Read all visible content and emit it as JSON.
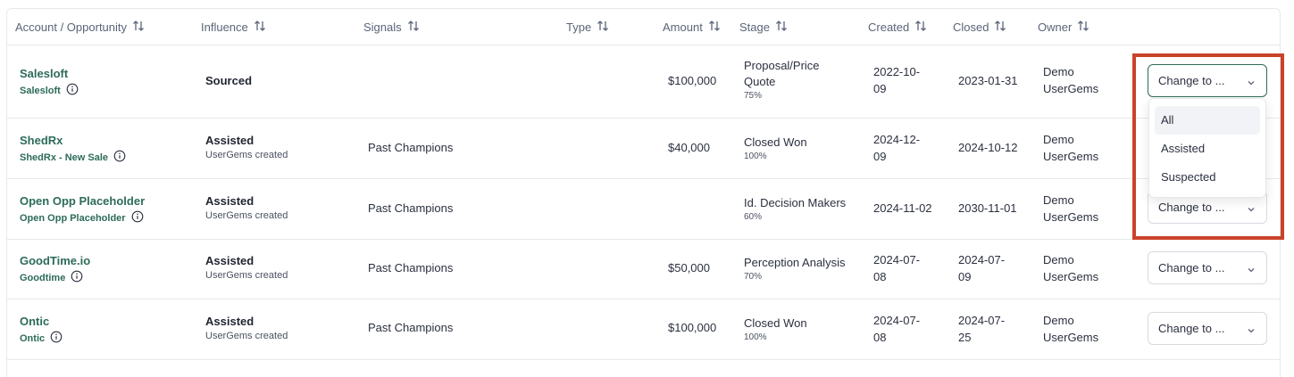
{
  "columns": [
    {
      "label": "Account / Opportunity"
    },
    {
      "label": "Influence"
    },
    {
      "label": "Signals"
    },
    {
      "label": "Type"
    },
    {
      "label": "Amount"
    },
    {
      "label": "Stage"
    },
    {
      "label": "Created"
    },
    {
      "label": "Closed"
    },
    {
      "label": "Owner"
    }
  ],
  "rows": [
    {
      "account": "Salesloft",
      "opportunity": "Salesloft",
      "influence": "Sourced",
      "influence_sub": "",
      "signals": "",
      "amount": "$100,000",
      "stage_l1": "Proposal/Price",
      "stage_l2": "Quote",
      "stage_pct": "75%",
      "created_l1": "2022-10-",
      "created_l2": "09",
      "closed_l1": "2023-01-31",
      "closed_l2": "",
      "owner_l1": "Demo",
      "owner_l2": "UserGems",
      "action": "Change to ..."
    },
    {
      "account": "ShedRx",
      "opportunity": "ShedRx - New Sale",
      "influence": "Assisted",
      "influence_sub": "UserGems created",
      "signals": "Past Champions",
      "amount": "$40,000",
      "stage_l1": "Closed Won",
      "stage_l2": "",
      "stage_pct": "100%",
      "created_l1": "2024-12-",
      "created_l2": "09",
      "closed_l1": "2024-10-12",
      "closed_l2": "",
      "owner_l1": "Demo",
      "owner_l2": "UserGems",
      "action": ""
    },
    {
      "account": "Open Opp Placeholder",
      "opportunity": "Open Opp Placeholder",
      "influence": "Assisted",
      "influence_sub": "UserGems created",
      "signals": "Past Champions",
      "amount": "",
      "stage_l1": "Id. Decision Makers",
      "stage_l2": "",
      "stage_pct": "60%",
      "created_l1": "2024-11-02",
      "created_l2": "",
      "closed_l1": "2030-11-01",
      "closed_l2": "",
      "owner_l1": "Demo",
      "owner_l2": "UserGems",
      "action": "Change to ..."
    },
    {
      "account": "GoodTime.io",
      "opportunity": "Goodtime",
      "influence": "Assisted",
      "influence_sub": "UserGems created",
      "signals": "Past Champions",
      "amount": "$50,000",
      "stage_l1": "Perception Analysis",
      "stage_l2": "",
      "stage_pct": "70%",
      "created_l1": "2024-07-",
      "created_l2": "08",
      "closed_l1": "2024-07-",
      "closed_l2": "09",
      "owner_l1": "Demo",
      "owner_l2": "UserGems",
      "action": "Change to ..."
    },
    {
      "account": "Ontic",
      "opportunity": "Ontic",
      "influence": "Assisted",
      "influence_sub": "UserGems created",
      "signals": "Past Champions",
      "amount": "$100,000",
      "stage_l1": "Closed Won",
      "stage_l2": "",
      "stage_pct": "100%",
      "created_l1": "2024-07-",
      "created_l2": "08",
      "closed_l1": "2024-07-",
      "closed_l2": "25",
      "owner_l1": "Demo",
      "owner_l2": "UserGems",
      "action": "Change to ..."
    }
  ],
  "dropdown": {
    "options": [
      "All",
      "Assisted",
      "Suspected"
    ],
    "highlighted": "All"
  },
  "colors": {
    "accent_green": "#2d6b5a",
    "highlight_box": "#c9432a"
  }
}
